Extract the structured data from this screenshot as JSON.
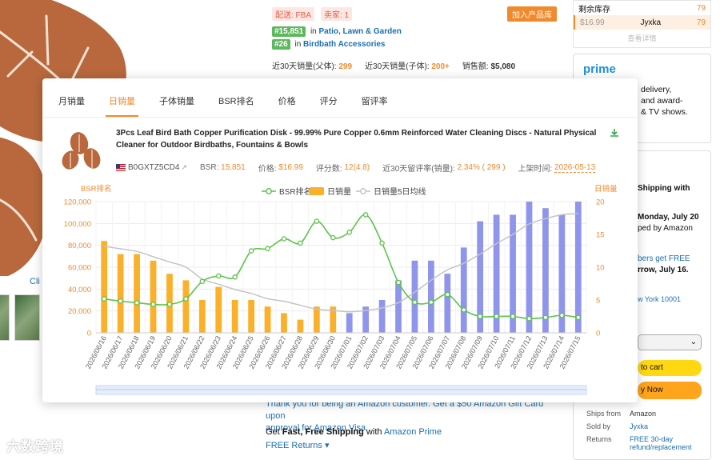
{
  "background": {
    "left": {
      "clip_text": "Cli",
      "watermark": "六数跨境"
    },
    "mid": {
      "tag1": "配送: FBA",
      "tag2": "卖家: 1",
      "add_button": "加入产品库",
      "rank1_value": "#15,851",
      "rank1_in": "in",
      "rank1_category": "Patio, Lawn & Garden",
      "rank2_value": "#26",
      "rank2_in": "in",
      "rank2_category": "Birdbath Accessories",
      "stat1_label": "近30天销量(父体):",
      "stat1_value": "299",
      "stat2_label": "近30天销量(子体):",
      "stat2_value": "200+",
      "stat3_label": "销售额:",
      "stat3_value": "$5,080",
      "blurb_prefix": "Thank you for being an Amazon customer. Get a $50 Amazon Gift Card upon",
      "blurb_line2": "approval for Amazon Visa.",
      "ship_text1": "Get ",
      "ship_bold": "Fast, Free Shipping",
      "ship_text2": " with ",
      "ship_link": "Amazon Prime",
      "free_returns": "FREE Returns"
    },
    "right": {
      "stock_label": "剩余库存",
      "stock_value": "79",
      "stock_price": "$16.99",
      "stock_seller": "Jyxka",
      "stock_num": "79",
      "stock_more": "查看详情",
      "prime_logo": "prime",
      "prime_line1": "delivery,",
      "prime_line2": "and award-",
      "prime_line3": "& TV shows.",
      "buy_line1": "Shipping with",
      "buy_line2": "Monday, July 20",
      "buy_line3": "ped by Amazon",
      "buy_line4": "bers get FREE",
      "buy_line5": "rrow, July 16.",
      "buy_line6": "w York 10001",
      "cart_label": "to cart",
      "now_label": "y Now",
      "ships_from_k": "Ships from",
      "ships_from_v": "Amazon",
      "sold_by_k": "Sold by",
      "sold_by_v": "Jyxka",
      "returns_k": "Returns",
      "returns_v": "FREE 30-day refund/replacement"
    }
  },
  "panel": {
    "tabs": [
      "月销量",
      "日销量",
      "子体销量",
      "BSR排名",
      "价格",
      "评分",
      "留评率"
    ],
    "active_tab": "日销量",
    "product_title": "3Pcs Leaf Bird Bath Copper Purification Disk - 99.99% Pure Copper 0.6mm Reinforced Water Cleaning Discs - Natural Physical Cleaner for Outdoor Birdbaths, Fountains & Bowls",
    "asin": "B0GXTZ5CD4",
    "bsr_label": "BSR:",
    "bsr_value": "15,851",
    "price_label": "价格:",
    "price_value": "$16.99",
    "rating_label": "评分数:",
    "rating_value": "12(4.8)",
    "review_rate_label": "近30天留评率(销量):",
    "review_rate_value": "2.34% ( 299 )",
    "listed_label": "上架时间:",
    "listed_value": "2026-05-13",
    "colors": {
      "accent": "#f08a2d",
      "bsr_line": "#5cc34a",
      "bar_orange": "#fbb02a",
      "bar_blue": "#8f95ea",
      "avg_line": "#c4c4c4"
    }
  },
  "chart_data": {
    "type": "bar",
    "legend": [
      "BSR排名",
      "日销量",
      "日销量5日均线"
    ],
    "ylabel_left": "BSR排名",
    "ylabel_right": "日销量",
    "yticks_left": [
      "0",
      "20,000",
      "40,000",
      "60,000",
      "80,000",
      "100,000",
      "120,000"
    ],
    "yticks_right": [
      "0",
      "5",
      "10",
      "15",
      "20"
    ],
    "ylim_left": [
      0,
      120000
    ],
    "ylim_right": [
      0,
      20
    ],
    "categories": [
      "2026/06/16",
      "2026/06/17",
      "2026/06/18",
      "2026/06/19",
      "2026/06/20",
      "2026/06/21",
      "2026/06/22",
      "2026/06/23",
      "2026/06/24",
      "2026/06/25",
      "2026/06/26",
      "2026/06/27",
      "2026/06/28",
      "2026/06/29",
      "2026/06/30",
      "2026/07/01",
      "2026/07/02",
      "2026/07/03",
      "2026/07/04",
      "2026/07/05",
      "2026/07/06",
      "2026/07/07",
      "2026/07/08",
      "2026/07/09",
      "2026/07/10",
      "2026/07/11",
      "2026/07/12",
      "2026/07/13",
      "2026/07/14",
      "2026/07/15"
    ],
    "series": [
      {
        "name": "日销量",
        "axis": "right",
        "values": [
          14,
          12,
          12,
          11,
          9,
          8,
          5,
          7,
          5,
          5,
          4,
          3,
          2,
          4,
          4,
          3,
          4,
          5,
          8,
          11,
          11,
          9,
          13,
          17,
          18,
          18,
          20,
          19,
          18,
          20
        ]
      },
      {
        "name": "BSR排名",
        "axis": "left",
        "values": [
          31000,
          29000,
          27500,
          26000,
          26000,
          31000,
          47000,
          52000,
          51000,
          75000,
          77000,
          86000,
          82000,
          102000,
          87000,
          92000,
          108000,
          82000,
          46000,
          28000,
          28000,
          35000,
          21000,
          15000,
          15000,
          15000,
          13000,
          14000,
          16000,
          14000
        ]
      },
      {
        "name": "日销量5日均线",
        "axis": "right",
        "values": [
          13.2,
          12.8,
          12.4,
          11.6,
          10.8,
          10.0,
          8.2,
          7.4,
          6.6,
          6.0,
          5.2,
          4.8,
          4.2,
          3.6,
          3.4,
          3.2,
          3.4,
          3.8,
          4.6,
          6.2,
          8.0,
          9.6,
          10.6,
          12.0,
          13.6,
          15.0,
          16.6,
          17.4,
          18.0,
          18.2
        ]
      }
    ],
    "bar_highlight_from_index": 15
  }
}
